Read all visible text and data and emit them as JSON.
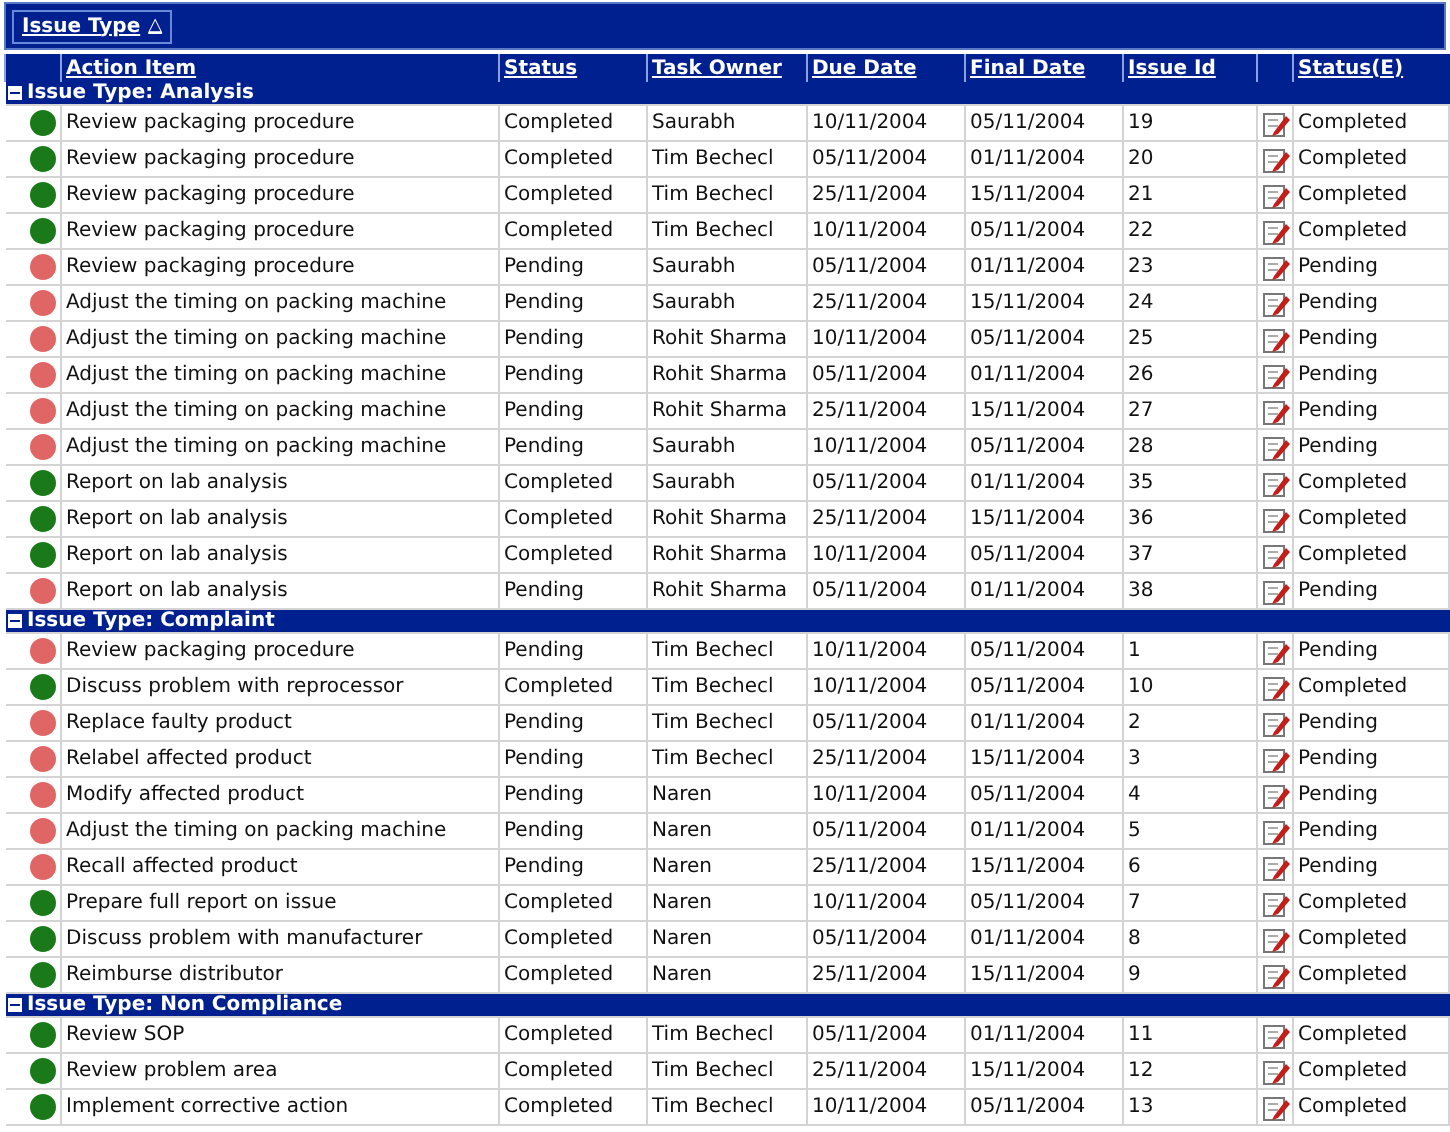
{
  "group_by": {
    "label": "Issue Type",
    "sort_indicator": "△"
  },
  "columns": [
    "Action Item",
    "Status",
    "Task Owner",
    "Due Date",
    "Final Date",
    "Issue Id",
    "Status(E)"
  ],
  "groups": [
    {
      "title": "Issue Type: Analysis",
      "expanded": true,
      "rows": [
        {
          "color": "#1a7a1a",
          "cells": [
            "Review packaging procedure",
            "Completed",
            "Saurabh",
            "10/11/2004",
            "05/11/2004",
            "19",
            "Completed"
          ]
        },
        {
          "color": "#1a7a1a",
          "cells": [
            "Review packaging procedure",
            "Completed",
            "Tim Bechecl",
            "05/11/2004",
            "01/11/2004",
            "20",
            "Completed"
          ]
        },
        {
          "color": "#1a7a1a",
          "cells": [
            "Review packaging procedure",
            "Completed",
            "Tim Bechecl",
            "25/11/2004",
            "15/11/2004",
            "21",
            "Completed"
          ]
        },
        {
          "color": "#1a7a1a",
          "cells": [
            "Review packaging procedure",
            "Completed",
            "Tim Bechecl",
            "10/11/2004",
            "05/11/2004",
            "22",
            "Completed"
          ]
        },
        {
          "color": "#e06666",
          "cells": [
            "Review packaging procedure",
            "Pending",
            "Saurabh",
            "05/11/2004",
            "01/11/2004",
            "23",
            "Pending"
          ]
        },
        {
          "color": "#e06666",
          "cells": [
            "Adjust the timing on packing machine",
            "Pending",
            "Saurabh",
            "25/11/2004",
            "15/11/2004",
            "24",
            "Pending"
          ]
        },
        {
          "color": "#e06666",
          "cells": [
            "Adjust the timing on packing machine",
            "Pending",
            "Rohit Sharma",
            "10/11/2004",
            "05/11/2004",
            "25",
            "Pending"
          ]
        },
        {
          "color": "#e06666",
          "cells": [
            "Adjust the timing on packing machine",
            "Pending",
            "Rohit Sharma",
            "05/11/2004",
            "01/11/2004",
            "26",
            "Pending"
          ]
        },
        {
          "color": "#e06666",
          "cells": [
            "Adjust the timing on packing machine",
            "Pending",
            "Rohit Sharma",
            "25/11/2004",
            "15/11/2004",
            "27",
            "Pending"
          ]
        },
        {
          "color": "#e06666",
          "cells": [
            "Adjust the timing on packing machine",
            "Pending",
            "Saurabh",
            "10/11/2004",
            "05/11/2004",
            "28",
            "Pending"
          ]
        },
        {
          "color": "#1a7a1a",
          "cells": [
            "Report on lab analysis",
            "Completed",
            "Saurabh",
            "05/11/2004",
            "01/11/2004",
            "35",
            "Completed"
          ]
        },
        {
          "color": "#1a7a1a",
          "cells": [
            "Report on lab analysis",
            "Completed",
            "Rohit Sharma",
            "25/11/2004",
            "15/11/2004",
            "36",
            "Completed"
          ]
        },
        {
          "color": "#1a7a1a",
          "cells": [
            "Report on lab analysis",
            "Completed",
            "Rohit Sharma",
            "10/11/2004",
            "05/11/2004",
            "37",
            "Completed"
          ]
        },
        {
          "color": "#e06666",
          "cells": [
            "Report on lab analysis",
            "Pending",
            "Rohit Sharma",
            "05/11/2004",
            "01/11/2004",
            "38",
            "Pending"
          ]
        }
      ]
    },
    {
      "title": "Issue Type: Complaint",
      "expanded": true,
      "rows": [
        {
          "color": "#e06666",
          "cells": [
            "Review packaging procedure",
            "Pending",
            "Tim Bechecl",
            "10/11/2004",
            "05/11/2004",
            "1",
            "Pending"
          ]
        },
        {
          "color": "#1a7a1a",
          "cells": [
            "Discuss problem with reprocessor",
            "Completed",
            "Tim Bechecl",
            "10/11/2004",
            "05/11/2004",
            "10",
            "Completed"
          ]
        },
        {
          "color": "#e06666",
          "cells": [
            "Replace faulty product",
            "Pending",
            "Tim Bechecl",
            "05/11/2004",
            "01/11/2004",
            "2",
            "Pending"
          ]
        },
        {
          "color": "#e06666",
          "cells": [
            "Relabel affected product",
            "Pending",
            "Tim Bechecl",
            "25/11/2004",
            "15/11/2004",
            "3",
            "Pending"
          ]
        },
        {
          "color": "#e06666",
          "cells": [
            "Modify affected product",
            "Pending",
            "Naren",
            "10/11/2004",
            "05/11/2004",
            "4",
            "Pending"
          ]
        },
        {
          "color": "#e06666",
          "cells": [
            "Adjust the timing on packing machine",
            "Pending",
            "Naren",
            "05/11/2004",
            "01/11/2004",
            "5",
            "Pending"
          ]
        },
        {
          "color": "#e06666",
          "cells": [
            "Recall affected product",
            "Pending",
            "Naren",
            "25/11/2004",
            "15/11/2004",
            "6",
            "Pending"
          ]
        },
        {
          "color": "#1a7a1a",
          "cells": [
            "Prepare full report on issue",
            "Completed",
            "Naren",
            "10/11/2004",
            "05/11/2004",
            "7",
            "Completed"
          ]
        },
        {
          "color": "#1a7a1a",
          "cells": [
            "Discuss problem with manufacturer",
            "Completed",
            "Naren",
            "05/11/2004",
            "01/11/2004",
            "8",
            "Completed"
          ]
        },
        {
          "color": "#1a7a1a",
          "cells": [
            "Reimburse distributor",
            "Completed",
            "Naren",
            "25/11/2004",
            "15/11/2004",
            "9",
            "Completed"
          ]
        }
      ]
    },
    {
      "title": "Issue Type: Non Compliance",
      "expanded": true,
      "rows": [
        {
          "color": "#1a7a1a",
          "cells": [
            "Review SOP",
            "Completed",
            "Tim Bechecl",
            "05/11/2004",
            "01/11/2004",
            "11",
            "Completed"
          ]
        },
        {
          "color": "#1a7a1a",
          "cells": [
            "Review problem area",
            "Completed",
            "Tim Bechecl",
            "25/11/2004",
            "15/11/2004",
            "12",
            "Completed"
          ]
        },
        {
          "color": "#1a7a1a",
          "cells": [
            "Implement corrective action",
            "Completed",
            "Tim Bechecl",
            "10/11/2004",
            "05/11/2004",
            "13",
            "Completed"
          ]
        }
      ]
    }
  ]
}
